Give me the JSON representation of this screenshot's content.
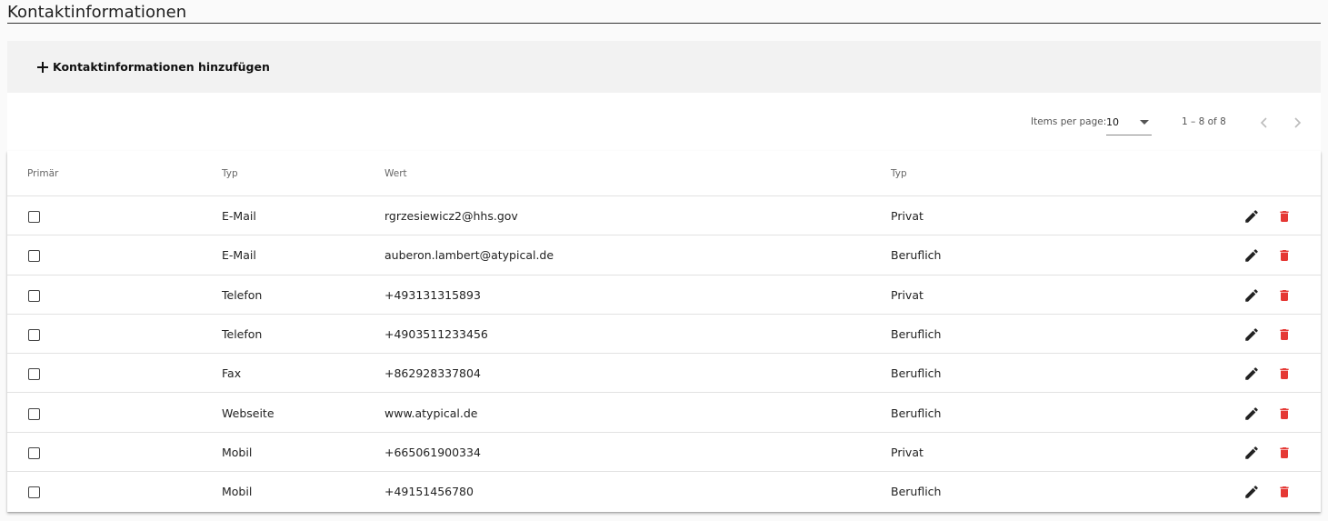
{
  "page": {
    "title": "Kontaktinformationen"
  },
  "toolbar": {
    "add_label": "Kontaktinformationen hinzufügen"
  },
  "paginator": {
    "items_per_page_label": "Items per page:",
    "items_per_page_value": "10",
    "range_label": "1 – 8 of 8"
  },
  "table": {
    "headers": [
      "Primär",
      "Typ",
      "Wert",
      "Typ"
    ],
    "rows": [
      {
        "primary": false,
        "typ": "E-Mail",
        "wert": "rgrzesiewicz2@hhs.gov",
        "kategorie": "Privat"
      },
      {
        "primary": false,
        "typ": "E-Mail",
        "wert": "auberon.lambert@atypical.de",
        "kategorie": "Beruflich"
      },
      {
        "primary": false,
        "typ": "Telefon",
        "wert": "+493131315893",
        "kategorie": "Privat"
      },
      {
        "primary": false,
        "typ": "Telefon",
        "wert": "+4903511233456",
        "kategorie": "Beruflich"
      },
      {
        "primary": false,
        "typ": "Fax",
        "wert": "+862928337804",
        "kategorie": "Beruflich"
      },
      {
        "primary": false,
        "typ": "Webseite",
        "wert": "www.atypical.de",
        "kategorie": "Beruflich"
      },
      {
        "primary": false,
        "typ": "Mobil",
        "wert": "+665061900334",
        "kategorie": "Privat"
      },
      {
        "primary": false,
        "typ": "Mobil",
        "wert": "+49151456780",
        "kategorie": "Beruflich"
      }
    ]
  },
  "icons": {
    "add": "plus-icon",
    "edit": "pencil-icon",
    "delete": "trash-icon",
    "prev": "chevron-left-icon",
    "next": "chevron-right-icon",
    "dropdown": "caret-down-icon"
  },
  "colors": {
    "delete_icon": "#e53935",
    "edit_icon": "#222222",
    "toolbar_bg": "#f2f2f2"
  }
}
